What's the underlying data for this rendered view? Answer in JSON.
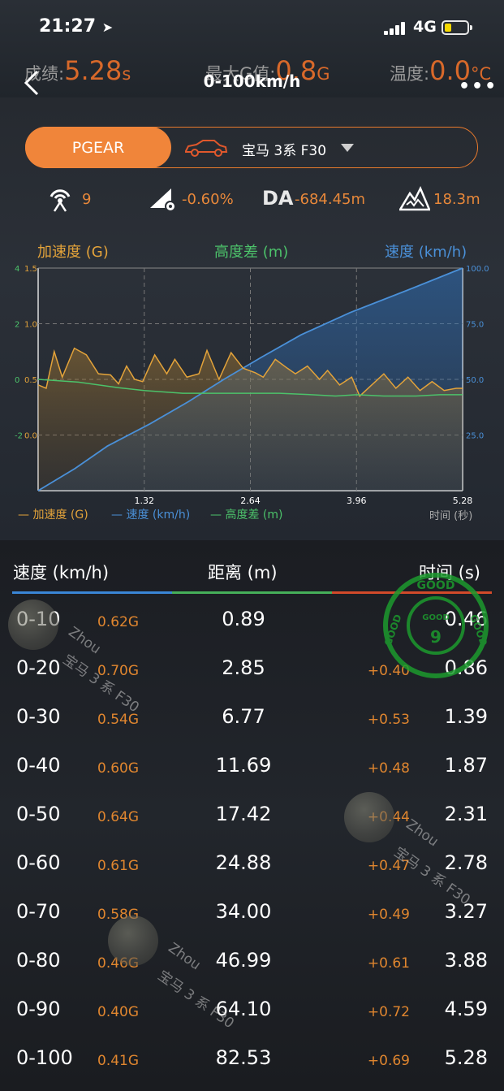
{
  "status": {
    "time": "21:27",
    "network": "4G"
  },
  "summary": {
    "result_label": "成绩:",
    "result_value": "5.28",
    "result_unit": "s",
    "maxg_label": "最大G值:",
    "maxg_value": "0.8",
    "maxg_unit": "G",
    "temp_label": "温度:",
    "temp_value": "0.0",
    "temp_unit": "°C"
  },
  "header": {
    "title": "0-100km/h",
    "more": "•••"
  },
  "selector": {
    "pgear": "PGEAR",
    "car": "宝马 3系 F30"
  },
  "stats": {
    "satellites": "9",
    "slope": "-0.60%",
    "da_label": "DA",
    "da_value": "-684.45m",
    "elevation": "18.3m"
  },
  "chart_data": {
    "type": "line",
    "header_labels": {
      "accel": "加速度 (G)",
      "altitude": "高度差 (m)",
      "speed": "速度 (km/h)"
    },
    "x_ticks": [
      "1.32",
      "2.64",
      "3.96",
      "5.28"
    ],
    "x_unit_label": "时间 (秒)",
    "xlim": [
      0,
      5.28
    ],
    "left_axis_alt_ticks": [
      "4",
      "2",
      "0",
      "-2"
    ],
    "left_axis_g_ticks": [
      "1.5",
      "1.0",
      "0.5",
      "0.0"
    ],
    "right_axis_speed_ticks": [
      "100.0",
      "75.0",
      "50.0",
      "25.0"
    ],
    "speed_ylim": [
      0,
      100
    ],
    "accel_ylim": [
      -0.5,
      1.5
    ],
    "altitude_ylim": [
      -4,
      4
    ],
    "legend": [
      "加速度 (G)",
      "速度 (km/h)",
      "高度差 (m)"
    ],
    "colors": {
      "accel": "#e3a33a",
      "speed": "#4a90d8",
      "altitude": "#4cc26a"
    },
    "series": [
      {
        "name": "速度 (km/h)",
        "x": [
          0,
          0.46,
          0.86,
          1.39,
          1.87,
          2.31,
          2.78,
          3.27,
          3.88,
          4.59,
          5.28
        ],
        "values": [
          0,
          10,
          20,
          30,
          40,
          50,
          60,
          70,
          80,
          90,
          100
        ]
      },
      {
        "name": "加速度 (G)",
        "x": [
          0,
          0.1,
          0.2,
          0.3,
          0.45,
          0.6,
          0.75,
          0.9,
          1.0,
          1.1,
          1.2,
          1.3,
          1.45,
          1.6,
          1.7,
          1.85,
          2.0,
          2.1,
          2.25,
          2.4,
          2.55,
          2.7,
          2.8,
          2.95,
          3.1,
          3.2,
          3.35,
          3.5,
          3.6,
          3.75,
          3.9,
          4.0,
          4.15,
          4.3,
          4.45,
          4.6,
          4.75,
          4.9,
          5.05,
          5.2,
          5.28
        ],
        "values": [
          0.45,
          0.42,
          0.75,
          0.52,
          0.78,
          0.72,
          0.55,
          0.54,
          0.46,
          0.62,
          0.5,
          0.48,
          0.72,
          0.55,
          0.68,
          0.52,
          0.55,
          0.76,
          0.5,
          0.74,
          0.6,
          0.56,
          0.52,
          0.68,
          0.6,
          0.55,
          0.62,
          0.5,
          0.58,
          0.45,
          0.52,
          0.35,
          0.45,
          0.55,
          0.42,
          0.52,
          0.4,
          0.48,
          0.4,
          0.42,
          0.42
        ]
      },
      {
        "name": "高度差 (m)",
        "x": [
          0,
          0.5,
          1.0,
          1.32,
          1.8,
          2.2,
          2.64,
          3.0,
          3.4,
          3.7,
          3.96,
          4.3,
          4.7,
          5.0,
          5.28
        ],
        "values": [
          0,
          -0.1,
          -0.3,
          -0.4,
          -0.5,
          -0.5,
          -0.5,
          -0.5,
          -0.55,
          -0.6,
          -0.55,
          -0.6,
          -0.6,
          -0.55,
          -0.55
        ]
      }
    ]
  },
  "table": {
    "header": {
      "speed": "速度 (km/h)",
      "distance": "距离 (m)",
      "time": "时间 (s)"
    },
    "rows": [
      {
        "speed": "0-10",
        "g": "0.62G",
        "distance": "0.89",
        "delta": "",
        "time": "0.46"
      },
      {
        "speed": "0-20",
        "g": "0.70G",
        "distance": "2.85",
        "delta": "+0.40",
        "time": "0.86"
      },
      {
        "speed": "0-30",
        "g": "0.54G",
        "distance": "6.77",
        "delta": "+0.53",
        "time": "1.39"
      },
      {
        "speed": "0-40",
        "g": "0.60G",
        "distance": "11.69",
        "delta": "+0.48",
        "time": "1.87"
      },
      {
        "speed": "0-50",
        "g": "0.64G",
        "distance": "17.42",
        "delta": "+0.44",
        "time": "2.31"
      },
      {
        "speed": "0-60",
        "g": "0.61G",
        "distance": "24.88",
        "delta": "+0.47",
        "time": "2.78"
      },
      {
        "speed": "0-70",
        "g": "0.58G",
        "distance": "34.00",
        "delta": "+0.49",
        "time": "3.27"
      },
      {
        "speed": "0-80",
        "g": "0.46G",
        "distance": "46.99",
        "delta": "+0.61",
        "time": "3.88"
      },
      {
        "speed": "0-90",
        "g": "0.40G",
        "distance": "64.10",
        "delta": "+0.72",
        "time": "4.59"
      },
      {
        "speed": "0-100",
        "g": "0.41G",
        "distance": "82.53",
        "delta": "+0.69",
        "time": "5.28"
      }
    ]
  },
  "stamp": {
    "text_top": "GOOD",
    "text_left": "GOOD",
    "text_right": "GOOD",
    "text_inner": "GOOD",
    "number": "9"
  },
  "watermark": {
    "name": "Zhou",
    "car": "宝马 3 系 F30"
  }
}
